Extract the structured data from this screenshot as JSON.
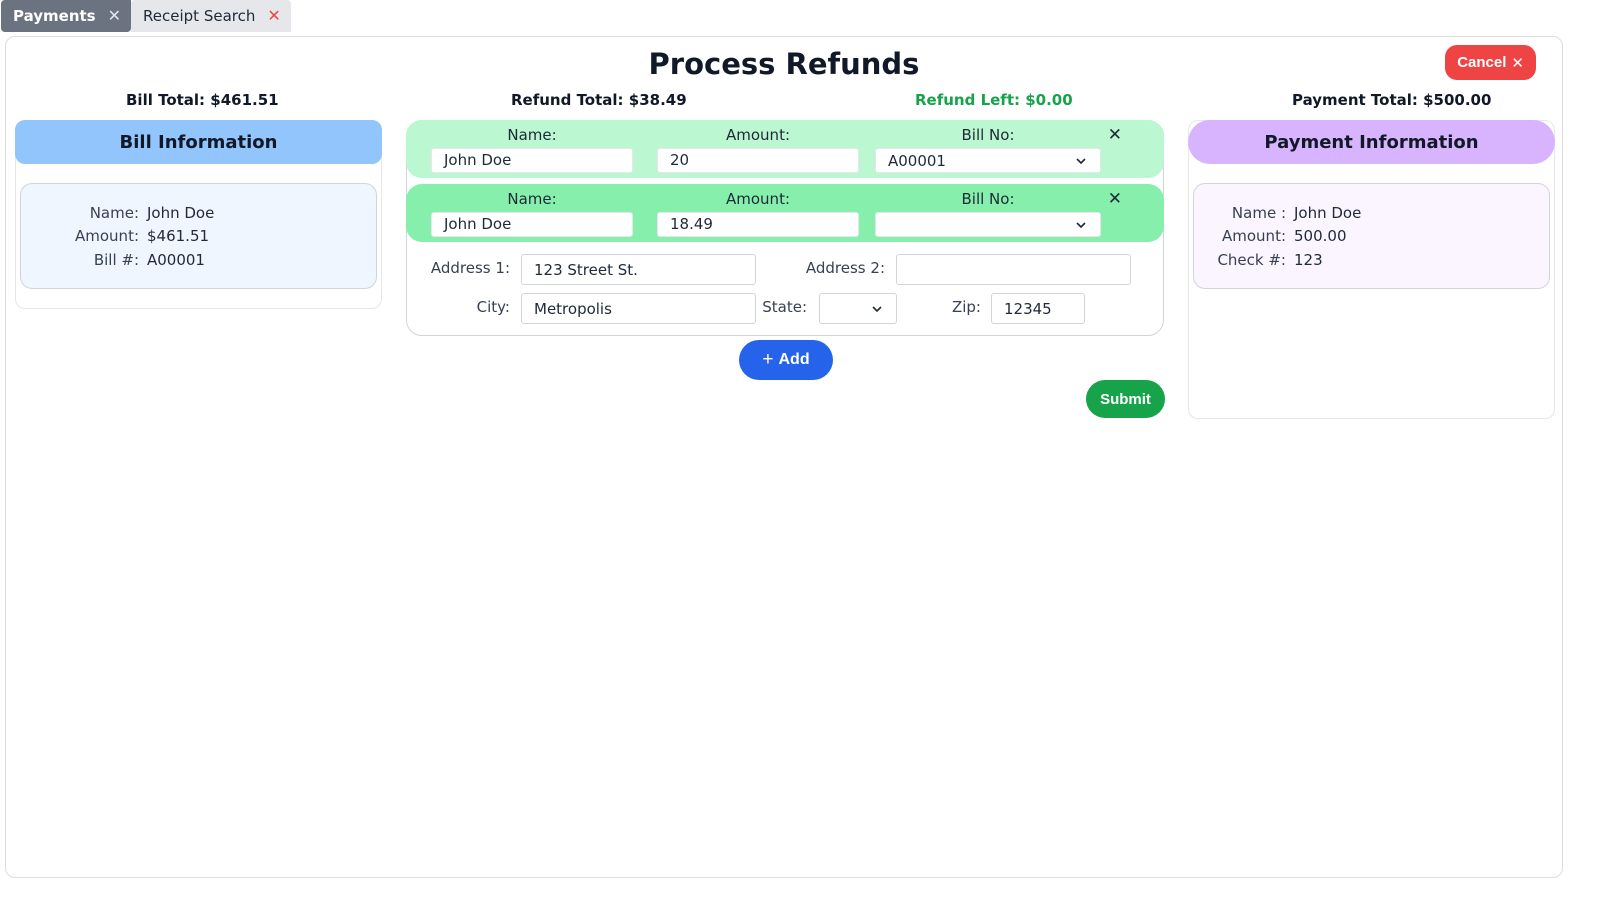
{
  "tabs": [
    {
      "label": "Payments",
      "active": true,
      "close_icon": "close-icon"
    },
    {
      "label": "Receipt Search",
      "active": false,
      "close_icon": "close-icon"
    }
  ],
  "header": {
    "title": "Process Refunds",
    "cancel_label": "Cancel",
    "cancel_icon": "×"
  },
  "totals": {
    "bill_total": "Bill Total: $461.51",
    "refund_total": "Refund Total: $38.49",
    "refund_left": "Refund Left: $0.00",
    "payment_total": "Payment Total: $500.00"
  },
  "bill_info": {
    "title": "Bill Information",
    "rows": [
      {
        "label": "Name:",
        "value": "John Doe"
      },
      {
        "label": "Amount:",
        "value": "$461.51"
      },
      {
        "label": "Bill #:",
        "value": "A00001"
      }
    ]
  },
  "payment_info": {
    "title": "Payment Information",
    "rows": [
      {
        "label": "Name :",
        "value": "John Doe"
      },
      {
        "label": "Amount:",
        "value": "500.00"
      },
      {
        "label": "Check #:",
        "value": "123"
      }
    ]
  },
  "refunds": {
    "labels": {
      "name": "Name:",
      "amount": "Amount:",
      "bill_no": "Bill No:"
    },
    "close_icon": "×",
    "rows": [
      {
        "name": "John Doe",
        "amount": "20",
        "bill_no": "A00001"
      },
      {
        "name": "John Doe",
        "amount": "18.49",
        "bill_no": ""
      }
    ]
  },
  "address": {
    "address1_label": "Address 1:",
    "address1_value": "123 Street St.",
    "address2_label": "Address 2:",
    "address2_value": "",
    "city_label": "City:",
    "city_value": "Metropolis",
    "state_label": "State:",
    "state_value": "",
    "zip_label": "Zip:",
    "zip_value": "12345"
  },
  "actions": {
    "add_label": "Add",
    "add_icon": "+",
    "submit_label": "Submit"
  },
  "colors": {
    "active_tab": "#6b7280",
    "cancel": "#ef4444",
    "bill_header": "#93c5fd",
    "payment_header": "#d8b4fe",
    "refund_row_1": "#bbf7d0",
    "refund_row_2": "#86efac",
    "refund_left": "#16a34a",
    "add": "#2563eb",
    "submit": "#16a34a"
  }
}
